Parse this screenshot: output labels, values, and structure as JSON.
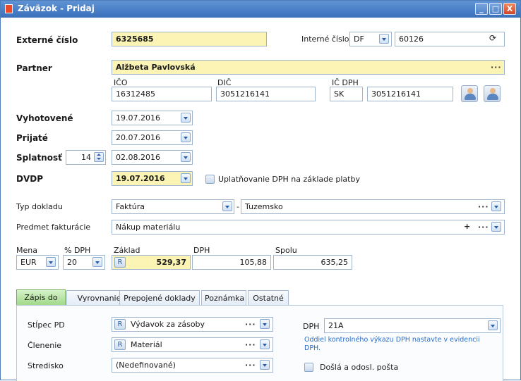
{
  "window": {
    "title": "Záväzok - Pridaj",
    "min": "_",
    "max": "□",
    "close": "X"
  },
  "external_number": {
    "label": "Externé číslo",
    "value": "6325685"
  },
  "internal_number": {
    "label": "Interné číslo",
    "series": "DF",
    "value": "60126",
    "refresh_icon": "⟳"
  },
  "partner": {
    "label": "Partner",
    "value": "Alžbeta Pavlovská",
    "ellipsis": "···"
  },
  "ico": {
    "label": "IČO",
    "value": "16312485"
  },
  "dic": {
    "label": "DIČ",
    "value": "3051216141"
  },
  "ic_dph": {
    "label": "IČ DPH",
    "prefix": "SK",
    "value": "3051216141"
  },
  "dates": {
    "issued": {
      "label": "Vyhotovené",
      "value": "19.07.2016"
    },
    "received": {
      "label": "Prijaté",
      "value": "20.07.2016"
    },
    "due": {
      "label": "Splatnosť",
      "days": "14",
      "value": "02.08.2016"
    },
    "dvdp": {
      "label": "DVDP",
      "value": "19.07.2016"
    }
  },
  "vat_on_payment": {
    "label": "Uplatňovanie DPH na základe platby"
  },
  "doc_type": {
    "label": "Typ dokladu",
    "value": "Faktúra",
    "separator": "-",
    "sub_value": "Tuzemsko"
  },
  "subject": {
    "label": "Predmet fakturácie",
    "value": "Nákup materiálu",
    "plus": "+"
  },
  "amounts": {
    "currency_label": "Mena",
    "currency": "EUR",
    "vat_pct_label": "% DPH",
    "vat_pct": "20",
    "base_label": "Základ",
    "base": "529,37",
    "r_badge": "R",
    "vat_label": "DPH",
    "vat": "105,88",
    "total_label": "Spolu",
    "total": "635,25"
  },
  "tabs": [
    "Zápis do",
    "Vyrovnanie",
    "Prepojené doklady",
    "Poznámka",
    "Ostatné"
  ],
  "entry": {
    "pd_column": {
      "label": "Stĺpec PD",
      "value": "Výdavok za zásoby"
    },
    "breakdown": {
      "label": "Členenie",
      "value": "Materiál"
    },
    "center": {
      "label": "Stredisko",
      "value": "(Nedefinované)"
    },
    "dph": {
      "label": "DPH",
      "value": "21A"
    },
    "note": "Oddiel kontrolného výkazu DPH nastavte v evidencii DPH.",
    "mail": {
      "label": "Došlá a odosl. pošta"
    }
  }
}
